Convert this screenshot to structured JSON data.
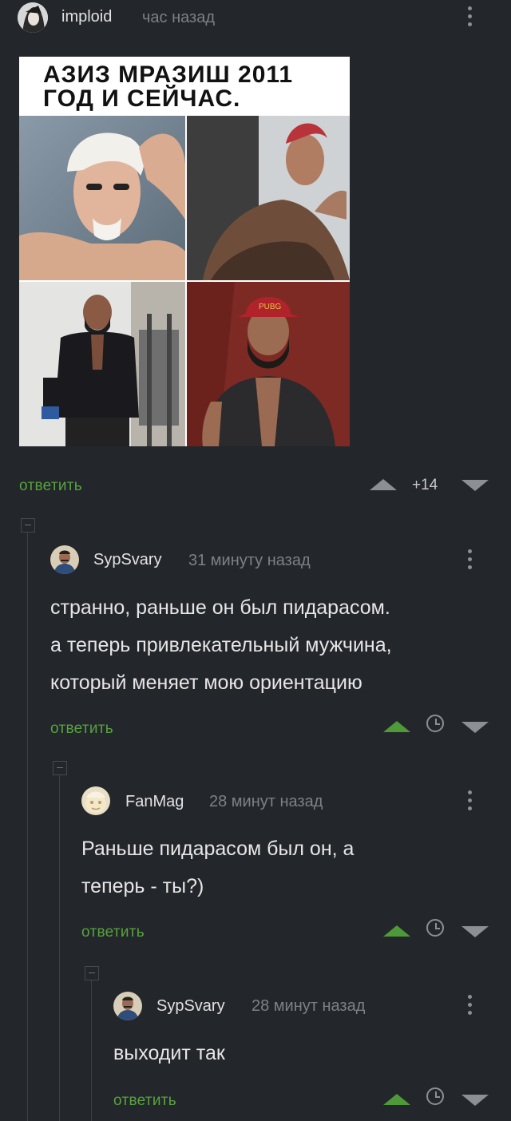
{
  "post": {
    "author": "imploid",
    "time": "час назад",
    "image": {
      "caption_line1": "АЗИЗ МРАЗИШ 2011",
      "caption_line2": "ГОД И СЕЙЧАС.",
      "cap_text": "PUBG"
    },
    "reply_label": "ответить",
    "score": "+14"
  },
  "comments": [
    {
      "author": "SypSvary",
      "time": "31 минуту назад",
      "lines": [
        "странно, раньше он был пидарасом.",
        "а теперь привлекательный мужчина,",
        "который меняет мою ориентацию"
      ],
      "reply_label": "ответить"
    },
    {
      "author": "FanMag",
      "time": "28 минут назад",
      "lines": [
        "Раньше пидарасом был он, а",
        "теперь - ты?)"
      ],
      "reply_label": "ответить"
    },
    {
      "author": "SypSvary",
      "time": "28 минут назад",
      "lines": [
        "выходит так"
      ],
      "reply_label": "ответить"
    }
  ],
  "colors": {
    "background": "#23262b",
    "reply_green": "#57a33d",
    "upvoted_green": "#4f9a38",
    "muted": "#8c8f94"
  },
  "icons": [
    "more-vertical-icon",
    "upvote-arrow-icon",
    "downvote-arrow-icon",
    "save-later-clock-icon",
    "collapse-branch-icon"
  ]
}
